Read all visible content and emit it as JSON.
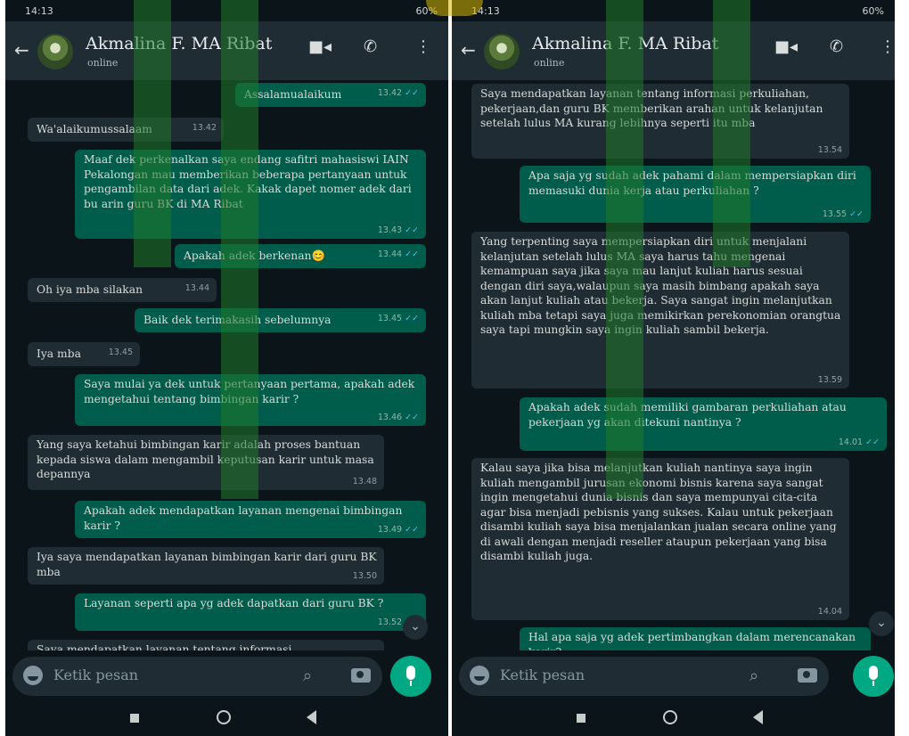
{
  "left": {
    "status_time": "14:13",
    "status_right": "60%",
    "contact_name": "Akmalina F. MA Ribat",
    "contact_status": "online",
    "messages": [
      {
        "text": "Assalamualaikum",
        "time": "13.42"
      },
      {
        "text": "Wa'alaikumussalaam",
        "time": "13.42"
      },
      {
        "text": "Maaf dek perkenalkan saya endang safitri mahasiswi IAIN Pekalongan mau memberikan beberapa pertanyaan untuk pengambilan data dari adek. Kakak dapet nomer adek dari bu arin guru BK di MA Ribat",
        "time": "13.43"
      },
      {
        "text": "Apakah adek berkenan😊",
        "time": "13.44"
      },
      {
        "text": "Oh iya mba silakan",
        "time": "13.44"
      },
      {
        "text": "Baik dek terimakasih sebelumnya",
        "time": "13.45"
      },
      {
        "text": "Iya mba",
        "time": "13.45"
      },
      {
        "text": "Saya mulai ya dek untuk pertanyaan pertama, apakah adek mengetahui tentang bimbingan karir ?",
        "time": "13.46"
      },
      {
        "text": "Yang saya ketahui bimbingan karir adalah proses bantuan kepada siswa dalam mengambil keputusan karir untuk masa depannya",
        "time": "13.48"
      },
      {
        "text": "Apakah adek mendapatkan layanan mengenai bimbingan karir ?",
        "time": "13.49"
      },
      {
        "text": "Iya saya mendapatkan layanan bimbingan karir dari guru BK mba",
        "time": "13.50"
      },
      {
        "text": "Layanan seperti apa yg adek dapatkan dari guru BK ?",
        "time": "13.52"
      },
      {
        "text": "Saya mendapatkan layanan tentang informasi",
        "time": ""
      }
    ],
    "input_placeholder": "Ketik pesan"
  },
  "right": {
    "status_time": "14:13",
    "status_right": "60%",
    "contact_name": "Akmalina F. MA Ribat",
    "contact_status": "online",
    "messages": [
      {
        "text": "Saya mendapatkan layanan tentang informasi perkuliahan, pekerjaan,dan guru BK memberikan arahan untuk kelanjutan setelah lulus MA kurang lebihnya seperti itu mba",
        "time": "13.54"
      },
      {
        "text": "Apa saja yg sudah adek pahami dalam mempersiapkan diri memasuki dunia kerja atau perkuliahan ?",
        "time": "13.55"
      },
      {
        "text": "Yang terpenting saya mempersiapkan diri untuk menjalani kelanjutan setelah lulus MA saya harus tahu mengenai kemampuan saya jika saya mau lanjut kuliah harus sesuai dengan diri saya,walaupun saya masih bimbang apakah saya akan lanjut kuliah atau bekerja. Saya sangat ingin melanjutkan kuliah mba tetapi saya juga memikirkan perekonomian orangtua saya tapi mungkin saya ingin kuliah sambil bekerja.",
        "time": "13.59"
      },
      {
        "text": "Apakah adek sudah memiliki gambaran perkuliahan atau pekerjaan yg akan ditekuni nantinya ?",
        "time": "14.01"
      },
      {
        "text": "Kalau saya jika bisa melanjutkan kuliah nantinya saya ingin kuliah mengambil jurusan ekonomi bisnis karena saya sangat ingin mengetahui dunia bisnis dan saya mempunyai cita-cita agar bisa menjadi pebisnis yang sukses. Kalau untuk pekerjaan disambi kuliah saya bisa menjalankan jualan secara online yang di awali dengan menjadi reseller ataupun pekerjaan yang bisa disambi kuliah juga.",
        "time": "14.04"
      },
      {
        "text": "Hal apa saja yg adek pertimbangkan dalam merencanakan karir?",
        "time": ""
      }
    ],
    "input_placeholder": "Ketik pesan"
  },
  "colors": {
    "outgoing": "#005c4b",
    "incoming": "#1f2c33",
    "accent": "#00a884",
    "background": "#0b1519"
  },
  "icons": [
    "back-arrow-icon",
    "video-call-icon",
    "phone-icon",
    "more-icon",
    "emoji-icon",
    "attach-icon",
    "camera-icon",
    "mic-icon",
    "scroll-down-icon"
  ]
}
